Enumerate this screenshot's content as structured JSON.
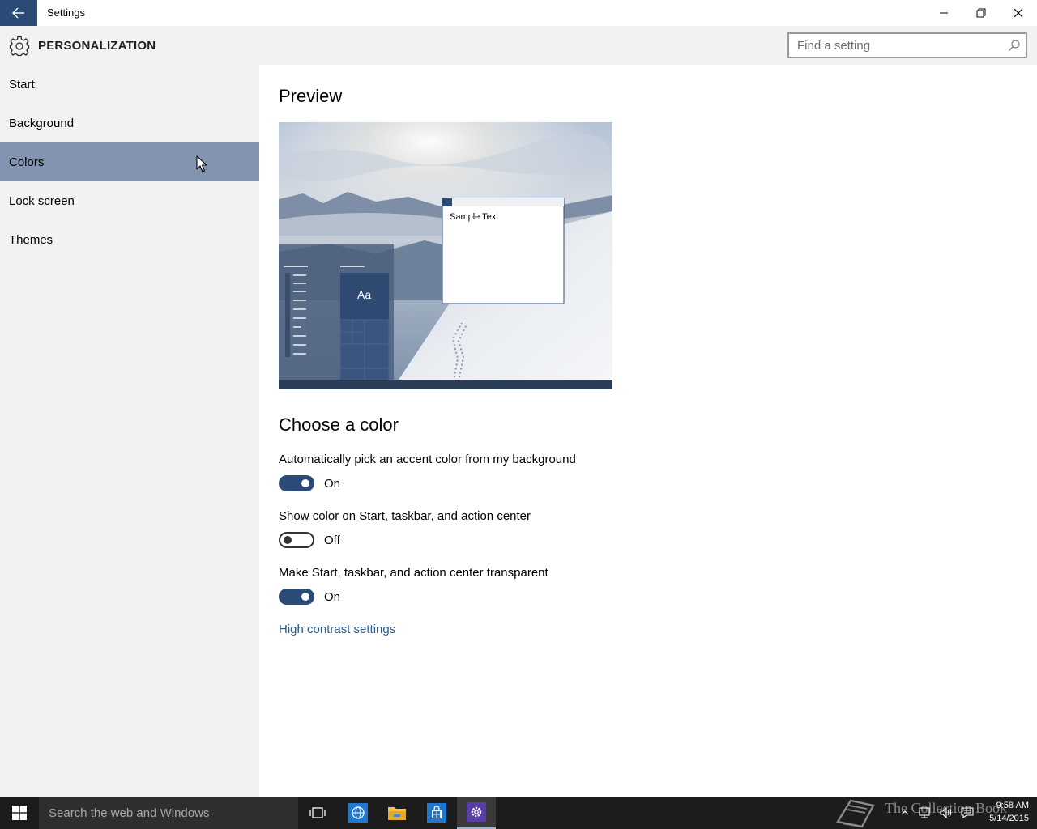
{
  "window": {
    "title": "Settings"
  },
  "header": {
    "title": "PERSONALIZATION",
    "search_placeholder": "Find a setting"
  },
  "sidebar": {
    "items": [
      {
        "label": "Start",
        "selected": false
      },
      {
        "label": "Background",
        "selected": false
      },
      {
        "label": "Colors",
        "selected": true
      },
      {
        "label": "Lock screen",
        "selected": false
      },
      {
        "label": "Themes",
        "selected": false
      }
    ]
  },
  "main": {
    "preview_title": "Preview",
    "preview_sample_text": "Sample Text",
    "preview_tile_text": "Aa",
    "choose_color_title": "Choose a color",
    "settings": [
      {
        "label": "Automatically pick an accent color from my background",
        "state": "On",
        "on": true
      },
      {
        "label": "Show color on Start, taskbar, and action center",
        "state": "Off",
        "on": false
      },
      {
        "label": "Make Start, taskbar, and action center transparent",
        "state": "On",
        "on": true
      }
    ],
    "high_contrast_link": "High contrast settings"
  },
  "taskbar": {
    "search_placeholder": "Search the web and Windows",
    "time": "9:58 AM",
    "date": "5/14/2015",
    "watermark": "The Collection Book"
  },
  "colors": {
    "accent": "#2b4b76",
    "sidebar_selected": "#8294b0",
    "link": "#2b5a8a"
  }
}
